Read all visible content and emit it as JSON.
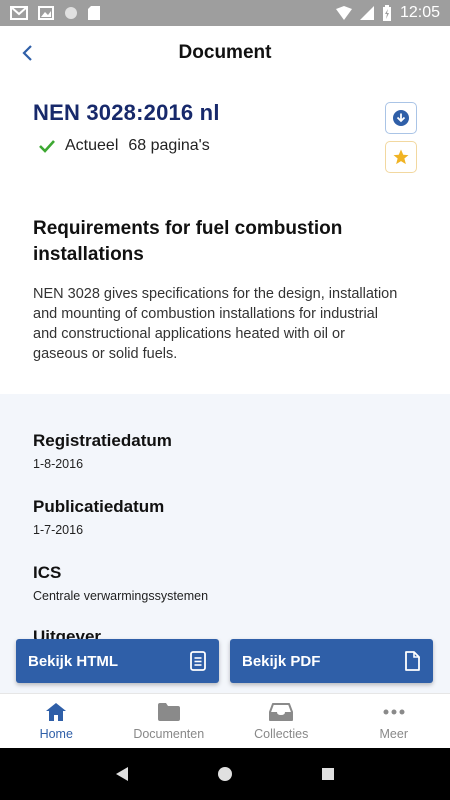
{
  "statusbar": {
    "time": "12:05"
  },
  "appbar": {
    "title": "Document"
  },
  "document": {
    "code": "NEN 3028:2016 nl",
    "status": "Actueel",
    "pages": "68 pagina's",
    "title": "Requirements for fuel combustion installations",
    "description": "NEN 3028 gives specifications for the design, installation and mounting of combustion installations for industrial and constructional applications heated with oil or gaseous or solid fuels."
  },
  "metadata": [
    {
      "label": "Registratiedatum",
      "value": "1-8-2016"
    },
    {
      "label": "Publicatiedatum",
      "value": "1-7-2016"
    },
    {
      "label": "ICS",
      "value": "Centrale verwarmingssystemen"
    },
    {
      "label": "Uitgever",
      "value": ""
    }
  ],
  "actions": {
    "html": "Bekijk HTML",
    "pdf": "Bekijk PDF"
  },
  "nav": [
    {
      "label": "Home",
      "icon": "home-icon"
    },
    {
      "label": "Documenten",
      "icon": "folder-icon"
    },
    {
      "label": "Collecties",
      "icon": "inbox-icon"
    },
    {
      "label": "Meer",
      "icon": "more-icon"
    }
  ],
  "colors": {
    "accent": "#2f5fa8",
    "code": "#17296b",
    "check": "#3da832",
    "star": "#f0b323"
  }
}
